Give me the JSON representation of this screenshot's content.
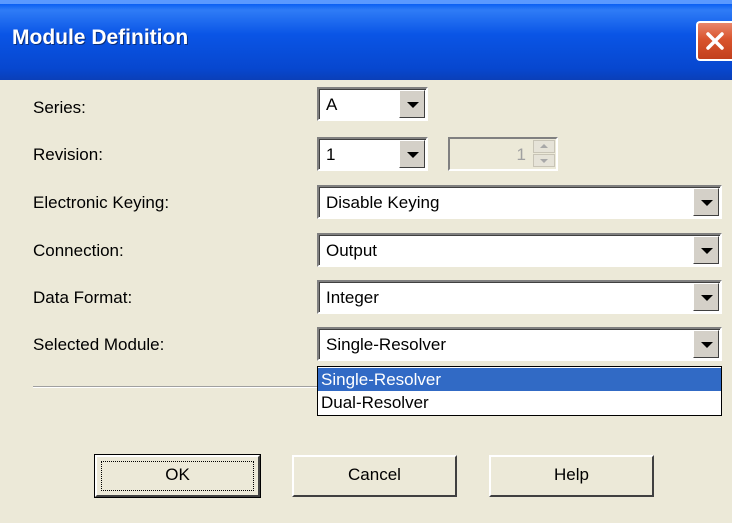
{
  "window": {
    "title": "Module Definition",
    "close_icon": "close-icon"
  },
  "form": {
    "series": {
      "label": "Series:",
      "value": "A"
    },
    "revision": {
      "label": "Revision:",
      "value": "1",
      "minor_value": "1"
    },
    "electronic_keying": {
      "label": "Electronic Keying:",
      "value": "Disable Keying"
    },
    "connection": {
      "label": "Connection:",
      "value": "Output"
    },
    "data_format": {
      "label": "Data Format:",
      "value": "Integer"
    },
    "selected_module": {
      "label": "Selected Module:",
      "value": "Single-Resolver",
      "options": [
        "Single-Resolver",
        "Dual-Resolver"
      ],
      "highlighted_option": "Single-Resolver"
    }
  },
  "buttons": {
    "ok": "OK",
    "cancel": "Cancel",
    "help": "Help"
  },
  "colors": {
    "titlebar": "#0a55e6",
    "selection": "#316ac5",
    "close_button": "#d9542d",
    "dialog_bg": "#ece9d8"
  }
}
